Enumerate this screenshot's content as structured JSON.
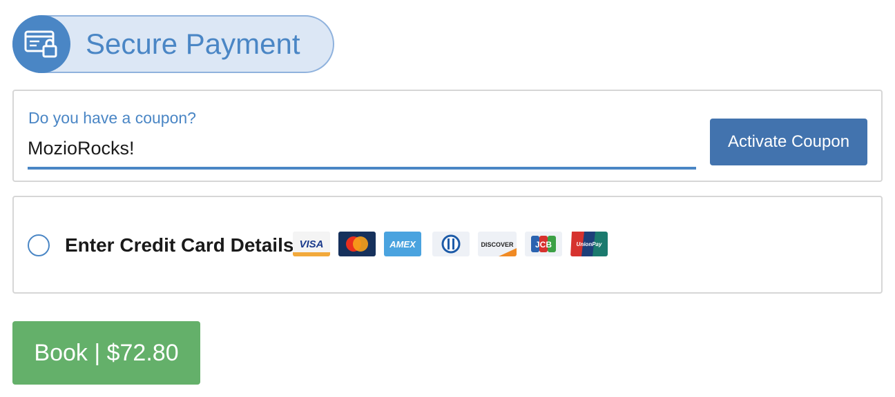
{
  "header": {
    "title": "Secure Payment",
    "icon": "credit-card-lock-icon"
  },
  "coupon": {
    "label": "Do you have a coupon?",
    "value": "MozioRocks!",
    "button_label": "Activate Coupon"
  },
  "payment": {
    "option_label": "Enter Credit Card Details",
    "selected": false,
    "cards": [
      {
        "name": "visa",
        "text": "VISA"
      },
      {
        "name": "mastercard",
        "text": ""
      },
      {
        "name": "amex",
        "text": "AMEX"
      },
      {
        "name": "diners",
        "text": ""
      },
      {
        "name": "discover",
        "text": "DISCOVER"
      },
      {
        "name": "jcb",
        "text": "JCB"
      },
      {
        "name": "unionpay",
        "text": "UnionPay"
      }
    ]
  },
  "book": {
    "label": "Book | $72.80"
  },
  "colors": {
    "accent": "#4a86c5",
    "button_blue": "#4273ae",
    "book_green": "#64b06a"
  }
}
